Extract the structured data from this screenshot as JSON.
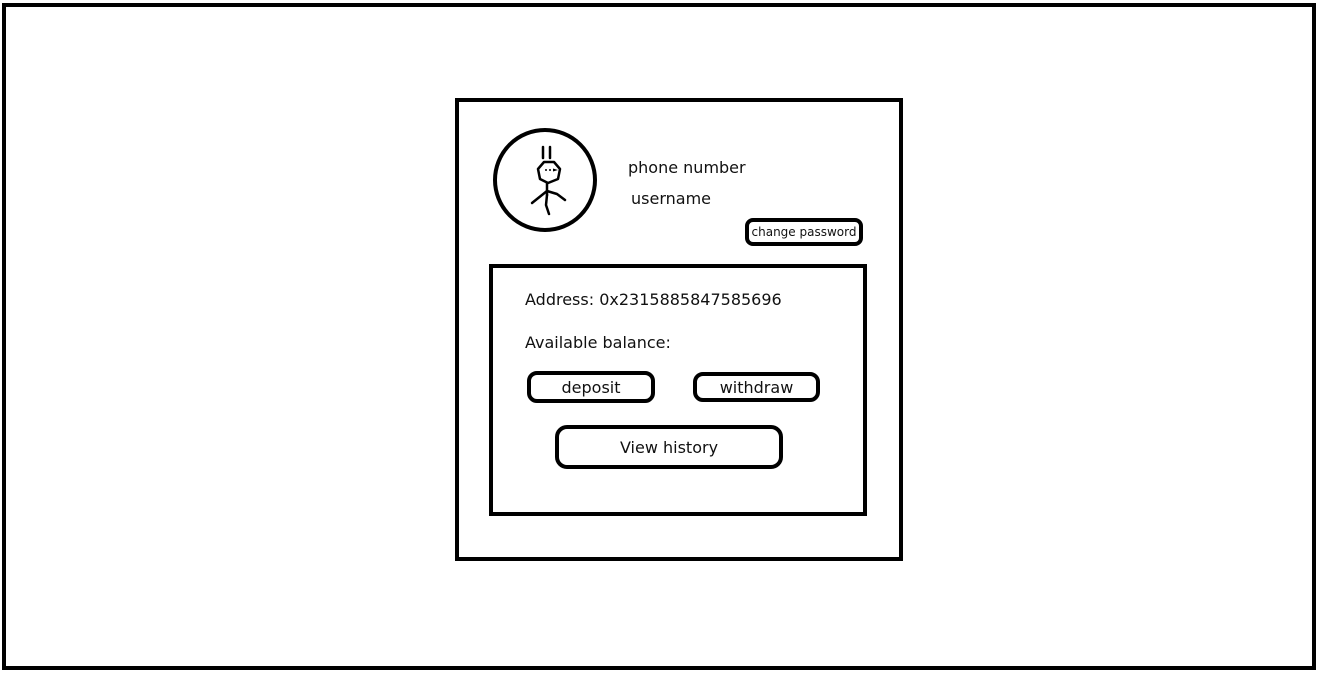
{
  "profile": {
    "avatar_icon": "stick-figure-avatar-icon",
    "phone_number_label": "phone number",
    "username_label": "username",
    "change_password_label": "change password"
  },
  "wallet": {
    "address_text": "Address: 0x2315885847585696",
    "balance_text": "Available balance:",
    "deposit_label": "deposit",
    "withdraw_label": "withdraw",
    "view_history_label": "View history"
  }
}
